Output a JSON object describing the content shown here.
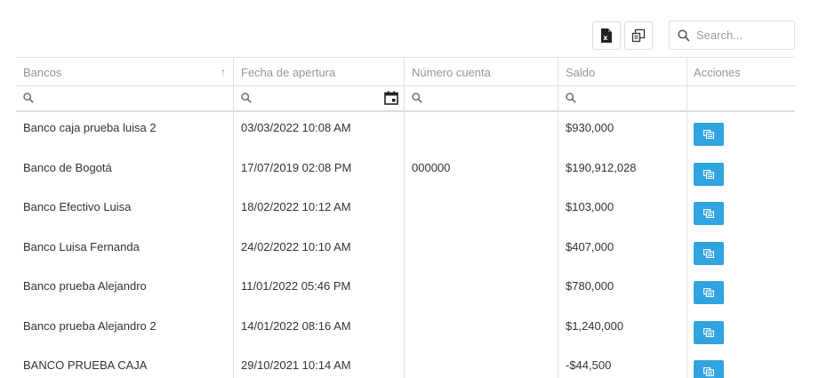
{
  "toolbar": {
    "excel_icon": "excel-export-icon",
    "columns_icon": "column-chooser-icon",
    "search_placeholder": "Search..."
  },
  "columns": [
    "Bancos",
    "Fecha de apertura",
    "Número cuenta",
    "Saldo",
    "Acciones"
  ],
  "sort_indicator": "↑",
  "rows": [
    {
      "banco": "Banco caja prueba luisa 2",
      "fecha": "03/03/2022 10:08 AM",
      "cuenta": "",
      "saldo": "$930,000"
    },
    {
      "banco": "Banco de Bogotá",
      "fecha": "17/07/2019 02:08 PM",
      "cuenta": "000000",
      "saldo": "$190,912,028"
    },
    {
      "banco": "Banco Efectivo Luisa",
      "fecha": "18/02/2022 10:12 AM",
      "cuenta": "",
      "saldo": "$103,000"
    },
    {
      "banco": "Banco Luisa Fernanda",
      "fecha": "24/02/2022 10:10 AM",
      "cuenta": "",
      "saldo": "$407,000"
    },
    {
      "banco": "Banco prueba Alejandro",
      "fecha": "11/01/2022 05:46 PM",
      "cuenta": "",
      "saldo": "$780,000"
    },
    {
      "banco": "Banco prueba Alejandro 2",
      "fecha": "14/01/2022 08:16 AM",
      "cuenta": "",
      "saldo": "$1,240,000"
    },
    {
      "banco": "BANCO PRUEBA CAJA",
      "fecha": "29/10/2021 10:14 AM",
      "cuenta": "",
      "saldo": "-$44,500"
    }
  ],
  "colors": {
    "action_button": "#2fa4e0",
    "border": "#e0e0e0",
    "header_text": "#959595"
  }
}
